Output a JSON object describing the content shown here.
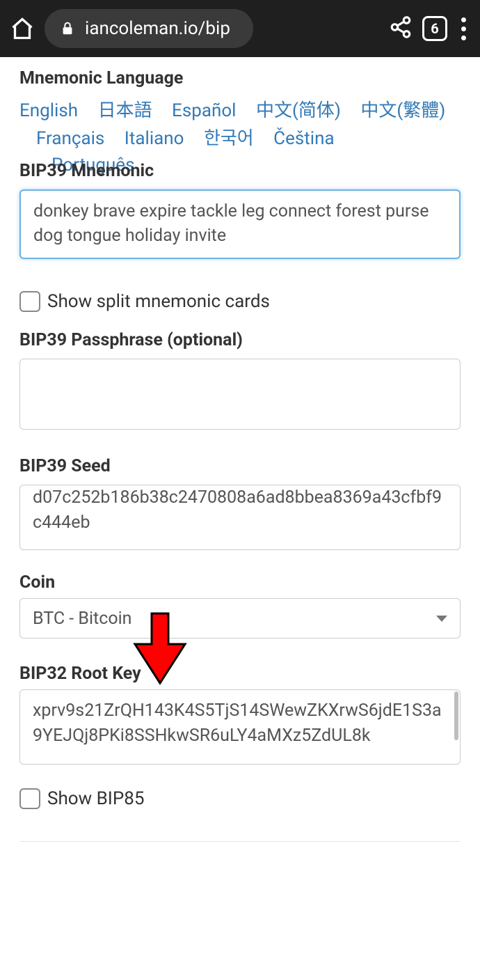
{
  "chrome": {
    "url": "iancoleman.io/bip",
    "tab_count": "6"
  },
  "labels": {
    "mnemonic_language": "Mnemonic Language",
    "bip39_mnemonic": "BIP39 Mnemonic",
    "show_split": "Show split mnemonic cards",
    "bip39_passphrase": "BIP39 Passphrase (optional)",
    "bip39_seed": "BIP39 Seed",
    "coin": "Coin",
    "bip32_root_key": "BIP32 Root Key",
    "show_bip85": "Show BIP85"
  },
  "languages": {
    "english": "English",
    "japanese": "日本語",
    "espanol": "Español",
    "zh_simplified": "中文(简体)",
    "zh_traditional": "中文(繁體)",
    "francais": "Français",
    "italiano": "Italiano",
    "korean": "한국어",
    "cestina": "Čeština",
    "portugues": "Português"
  },
  "fields": {
    "mnemonic": "donkey brave expire tackle leg connect forest purse dog tongue holiday invite",
    "passphrase": "",
    "seed": "d07c252b186b38c2470808a6ad8bbea8369a43cfbf9c444eb",
    "coin_selected": "BTC - Bitcoin",
    "root_key": "xprv9s21ZrQH143K4S5TjS14SWewZKXrwS6jdE1S3a9YEJQj8PKi8SSHkwSR6uLY4aMXz5ZdUL8k"
  }
}
